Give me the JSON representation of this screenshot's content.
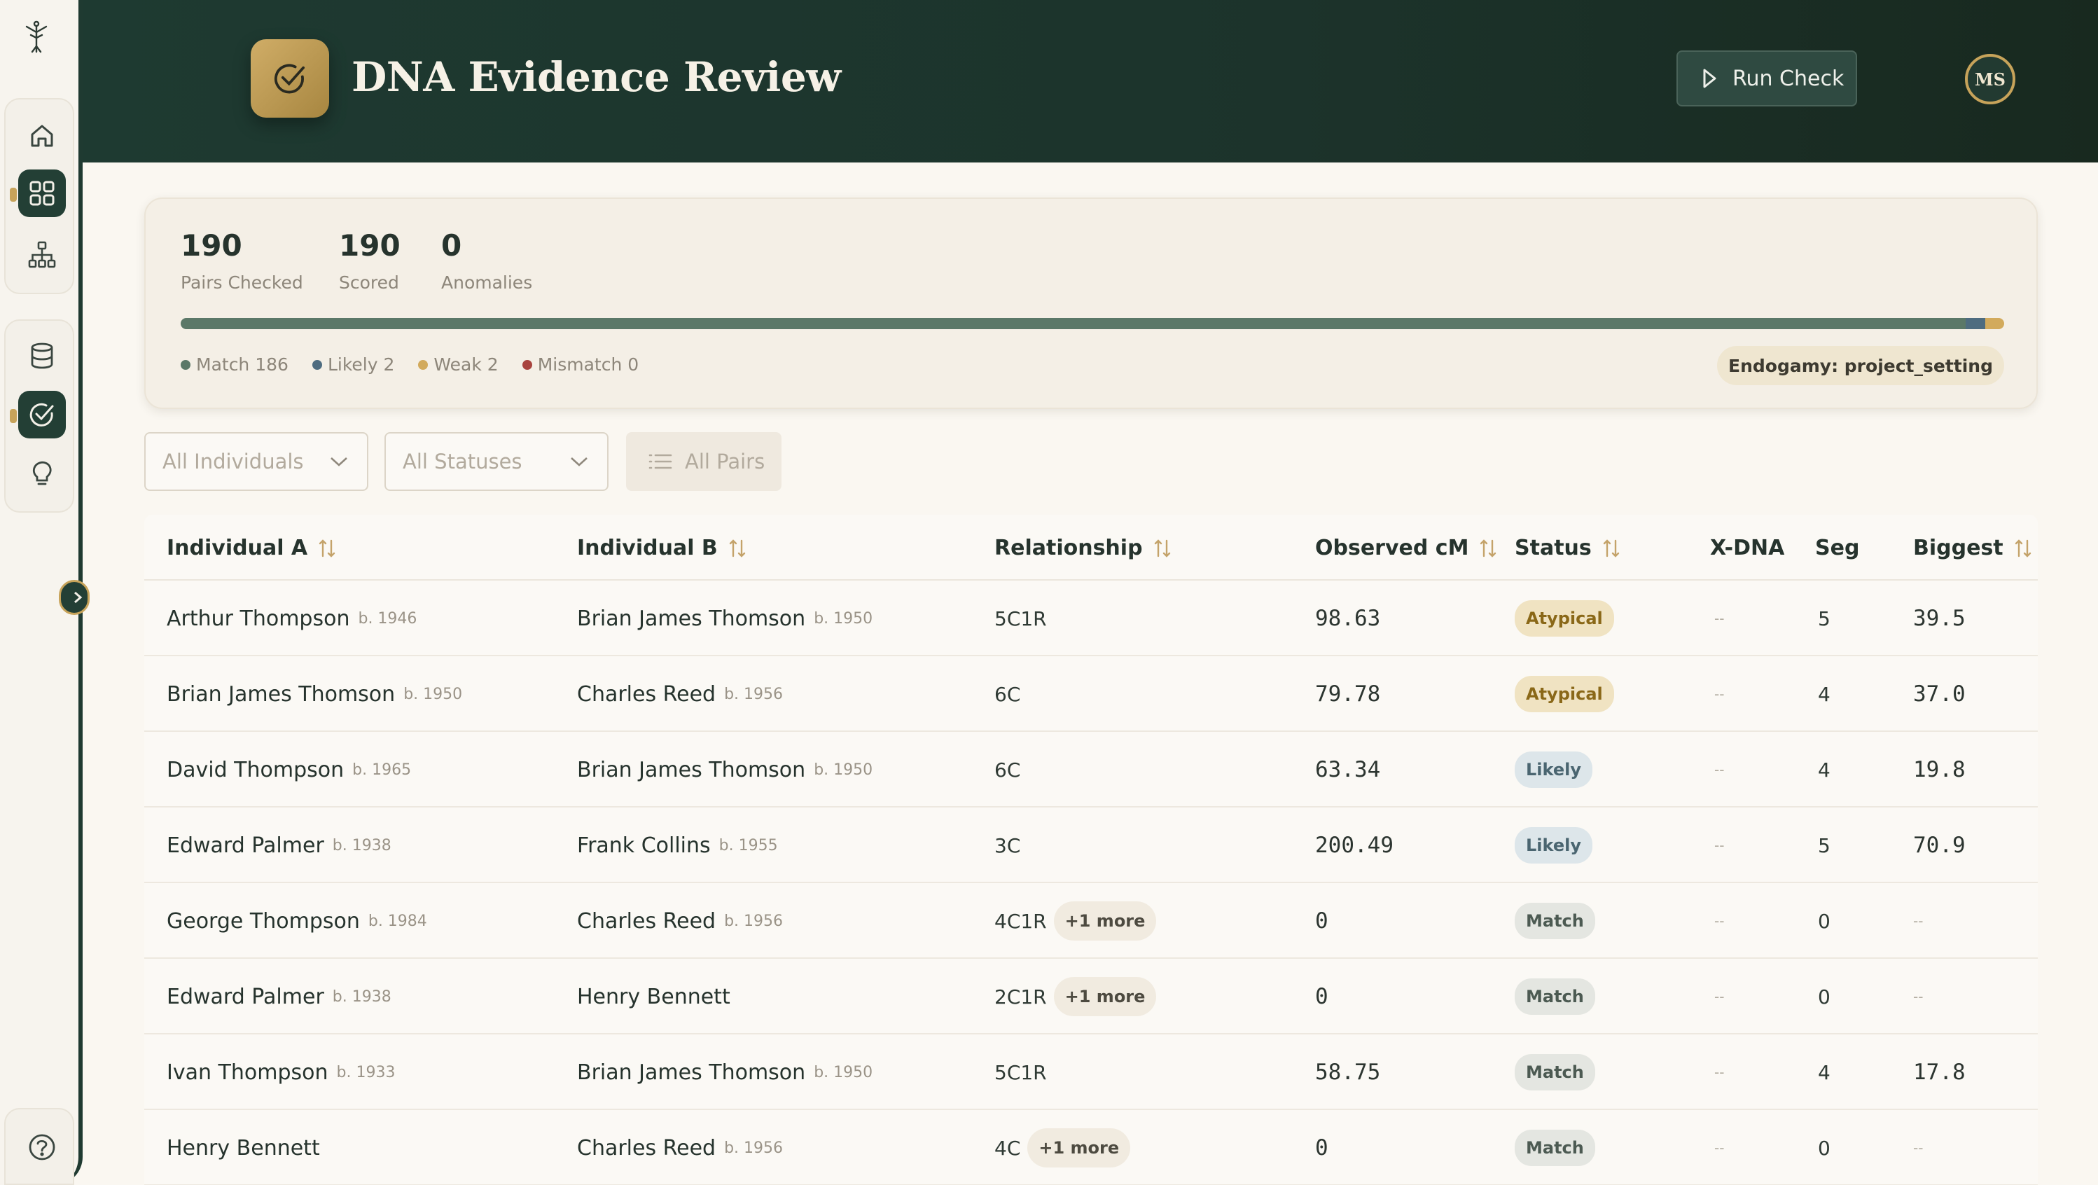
{
  "app": {
    "title": "DNA Evidence Review"
  },
  "header": {
    "run_label": "Run Check",
    "avatar_initials": "MS"
  },
  "summary": {
    "stats": [
      {
        "value": "190",
        "label": "Pairs Checked"
      },
      {
        "value": "190",
        "label": "Scored"
      },
      {
        "value": "0",
        "label": "Anomalies"
      }
    ],
    "progress": [
      {
        "name": "Match",
        "value": 186,
        "color": "#5b7868"
      },
      {
        "name": "Likely",
        "value": 2,
        "color": "#4e6c80"
      },
      {
        "name": "Weak",
        "value": 2,
        "color": "#d2aa5c"
      },
      {
        "name": "Mismatch",
        "value": 0,
        "color": "#a8433e"
      }
    ],
    "legend": [
      {
        "label": "Match 186",
        "color": "#5b7868"
      },
      {
        "label": "Likely 2",
        "color": "#4e6c80"
      },
      {
        "label": "Weak 2",
        "color": "#d2aa5c"
      },
      {
        "label": "Mismatch 0",
        "color": "#a8433e"
      }
    ],
    "endogamy": "Endogamy: project_setting"
  },
  "filters": {
    "individuals": "All Individuals",
    "statuses": "All Statuses",
    "pairs": "All Pairs"
  },
  "table": {
    "columns": [
      "Individual A",
      "Individual B",
      "Relationship",
      "Observed cM",
      "Status",
      "X-DNA",
      "Seg",
      "Biggest"
    ],
    "rows": [
      {
        "a": "Arthur Thompson",
        "a_birth": "b. 1946",
        "b": "Brian James Thomson",
        "b_birth": "b. 1950",
        "rel": "5C1R",
        "more": "",
        "cm": "98.63",
        "status": "Atypical",
        "status_kind": "atypical",
        "xdna": "--",
        "seg": "5",
        "biggest": "39.5"
      },
      {
        "a": "Brian James Thomson",
        "a_birth": "b. 1950",
        "b": "Charles Reed",
        "b_birth": "b. 1956",
        "rel": "6C",
        "more": "",
        "cm": "79.78",
        "status": "Atypical",
        "status_kind": "atypical",
        "xdna": "--",
        "seg": "4",
        "biggest": "37.0"
      },
      {
        "a": "David Thompson",
        "a_birth": "b. 1965",
        "b": "Brian James Thomson",
        "b_birth": "b. 1950",
        "rel": "6C",
        "more": "",
        "cm": "63.34",
        "status": "Likely",
        "status_kind": "likely",
        "xdna": "--",
        "seg": "4",
        "biggest": "19.8"
      },
      {
        "a": "Edward Palmer",
        "a_birth": "b. 1938",
        "b": "Frank Collins",
        "b_birth": "b. 1955",
        "rel": "3C",
        "more": "",
        "cm": "200.49",
        "status": "Likely",
        "status_kind": "likely",
        "xdna": "--",
        "seg": "5",
        "biggest": "70.9"
      },
      {
        "a": "George Thompson",
        "a_birth": "b. 1984",
        "b": "Charles Reed",
        "b_birth": "b. 1956",
        "rel": "4C1R",
        "more": "+1 more",
        "cm": "0",
        "status": "Match",
        "status_kind": "match",
        "xdna": "--",
        "seg": "0",
        "biggest": "--"
      },
      {
        "a": "Edward Palmer",
        "a_birth": "b. 1938",
        "b": "Henry Bennett",
        "b_birth": "",
        "rel": "2C1R",
        "more": "+1 more",
        "cm": "0",
        "status": "Match",
        "status_kind": "match",
        "xdna": "--",
        "seg": "0",
        "biggest": "--"
      },
      {
        "a": "Ivan Thompson",
        "a_birth": "b. 1933",
        "b": "Brian James Thomson",
        "b_birth": "b. 1950",
        "rel": "5C1R",
        "more": "",
        "cm": "58.75",
        "status": "Match",
        "status_kind": "match",
        "xdna": "--",
        "seg": "4",
        "biggest": "17.8"
      },
      {
        "a": "Henry Bennett",
        "a_birth": "",
        "b": "Charles Reed",
        "b_birth": "b. 1956",
        "rel": "4C",
        "more": "+1 more",
        "cm": "0",
        "status": "Match",
        "status_kind": "match",
        "xdna": "--",
        "seg": "0",
        "biggest": "--"
      }
    ]
  },
  "icons": {
    "logo": "tree-logo-icon",
    "nav": [
      "home-icon",
      "dashboard-grid-icon",
      "family-tree-icon",
      "database-icon",
      "check-circle-icon",
      "lightbulb-icon",
      "help-icon"
    ],
    "sort": "sort-arrows-icon",
    "chevron": "chevron-down-icon",
    "list": "list-icon",
    "play": "play-icon"
  },
  "colors": {
    "header_bg": "#1e3a31",
    "accent_gold": "#c7a35a"
  }
}
